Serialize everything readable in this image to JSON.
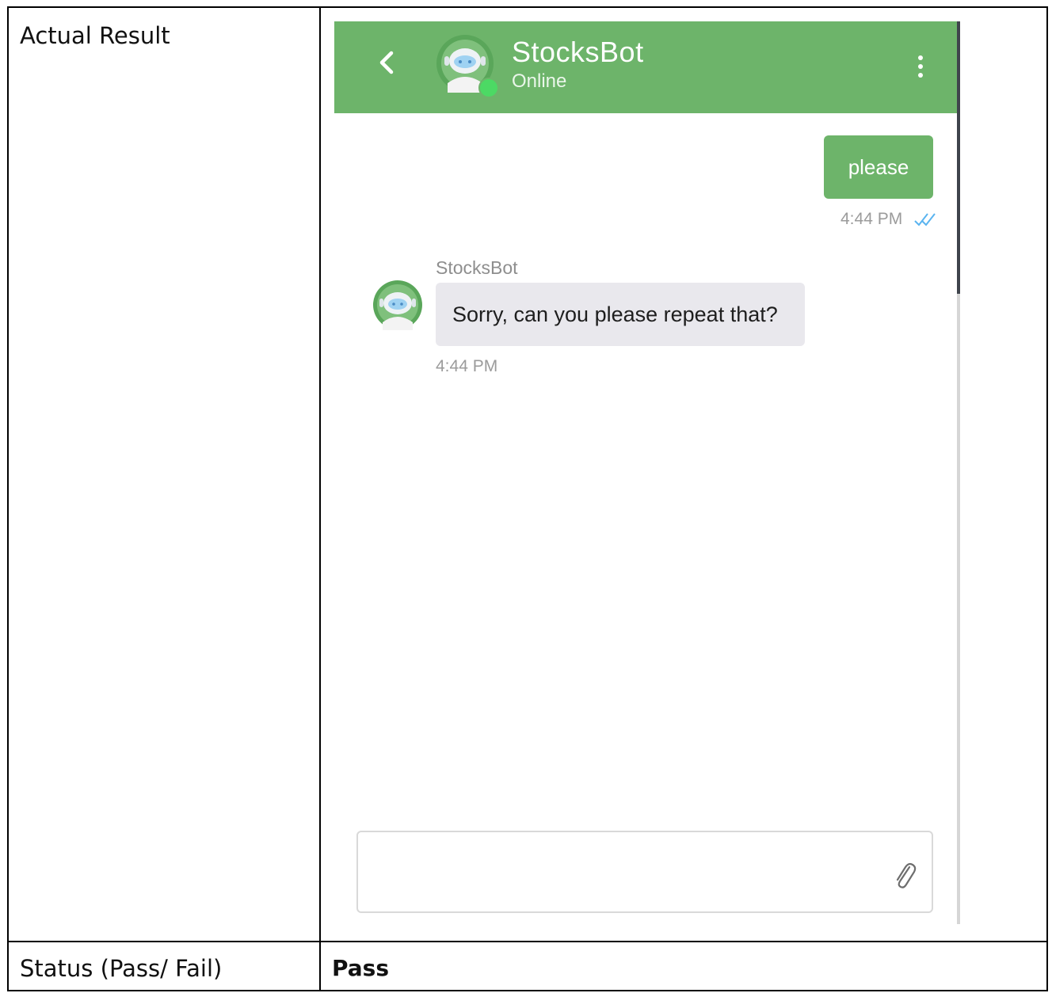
{
  "table": {
    "actual_result_label": "Actual Result",
    "status_label": "Status (Pass/ Fail)",
    "status_value": "Pass"
  },
  "chat": {
    "header": {
      "title": "StocksBot",
      "status": "Online",
      "back_icon": "chevron-left-icon",
      "menu_icon": "vertical-dots-icon"
    },
    "messages": [
      {
        "sender": "user",
        "text": "please",
        "time": "4:44 PM",
        "read_icon": "double-check-icon"
      },
      {
        "sender": "StocksBot",
        "text": "Sorry, can you please repeat that?",
        "time": "4:44 PM"
      }
    ],
    "composer": {
      "value": "",
      "attach_icon": "paperclip-icon"
    }
  },
  "colors": {
    "header_bg": "#6db46a",
    "user_bubble_bg": "#6db46a",
    "bot_bubble_bg": "#e9e8ed",
    "online_dot": "#4cd964",
    "read_ticks": "#5ab4f0"
  }
}
